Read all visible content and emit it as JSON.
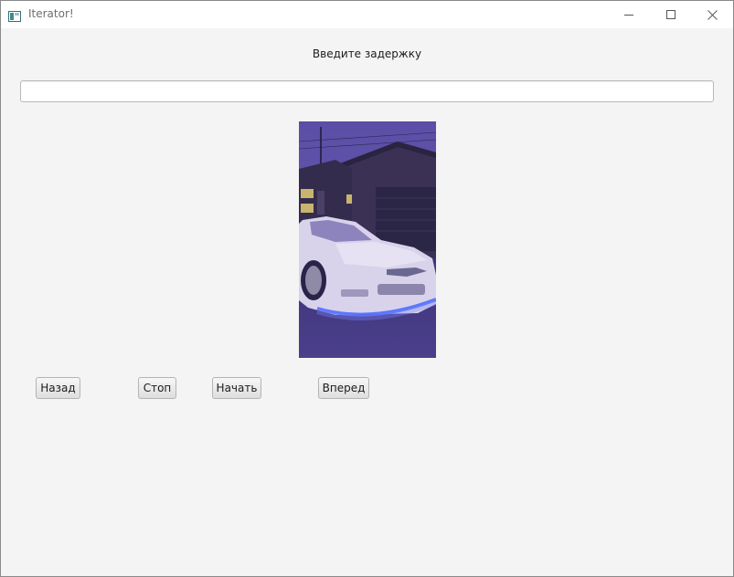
{
  "window": {
    "title": "Iterator!",
    "icon": "java-app-icon",
    "controls": {
      "minimize": "minimize-icon",
      "maximize": "maximize-icon",
      "close": "close-icon"
    }
  },
  "main": {
    "prompt_label": "Введите задержку",
    "delay_input": {
      "value": "",
      "placeholder": ""
    },
    "image": {
      "subject": "photo of a white drift car with blue underglow in front of a garage at dusk"
    },
    "buttons": {
      "back": "Назад",
      "stop": "Стоп",
      "start": "Начать",
      "forward": "Вперед"
    }
  }
}
